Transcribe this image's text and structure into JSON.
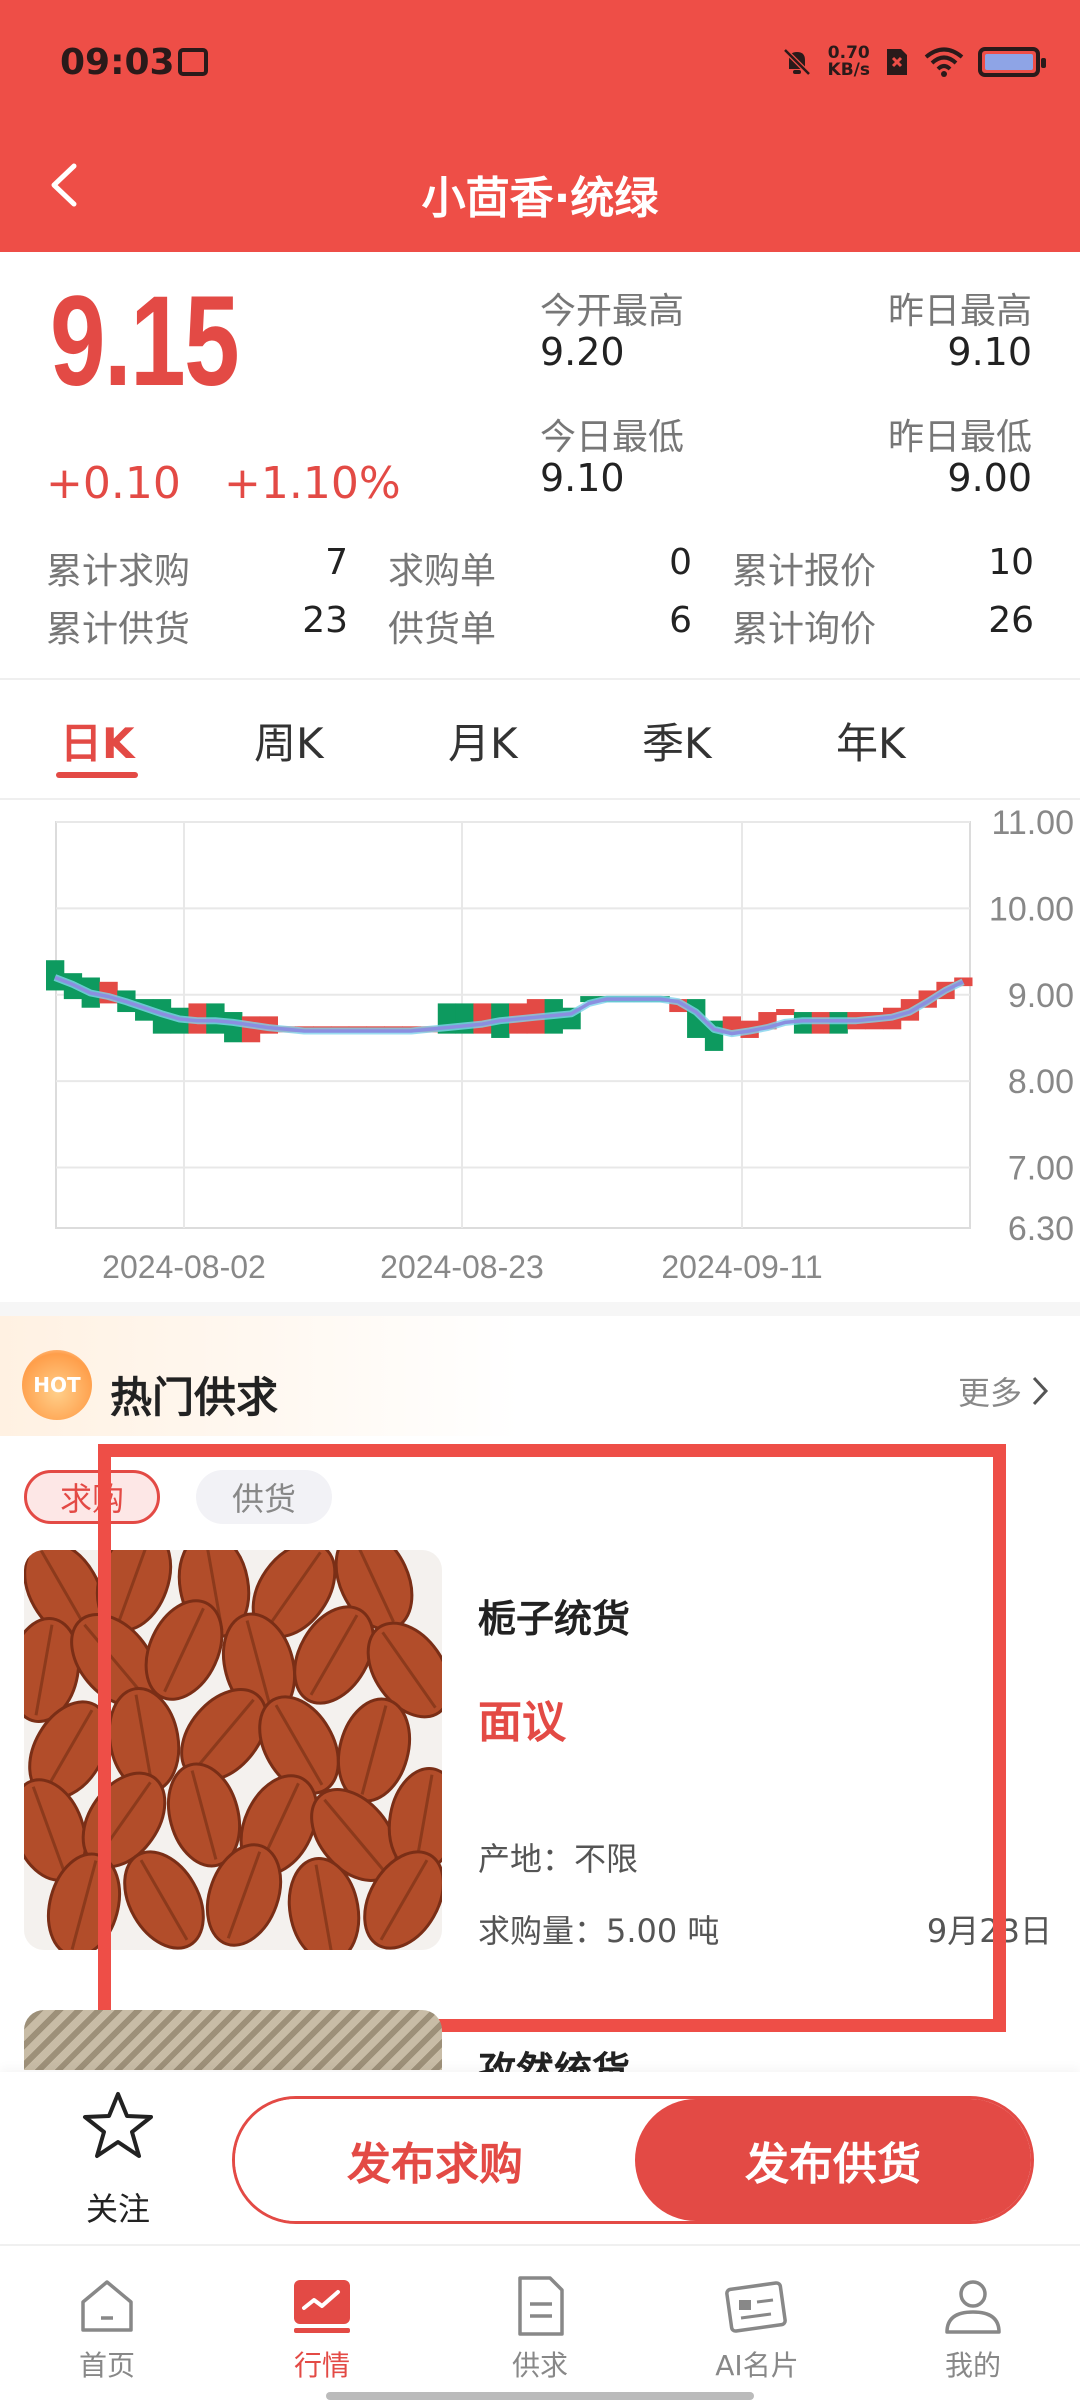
{
  "status_bar": {
    "time": "09:03",
    "net_speed_value": "0.70",
    "net_speed_unit": "KB/s"
  },
  "header": {
    "title": "小茴香·统绿"
  },
  "quote": {
    "price": "9.15",
    "change_abs": "+0.10",
    "change_pct": "+1.10%",
    "today_high_label": "今开最高",
    "today_high_value": "9.20",
    "yesterday_high_label": "昨日最高",
    "yesterday_high_value": "9.10",
    "today_low_label": "今日最低",
    "today_low_value": "9.10",
    "yesterday_low_label": "昨日最低",
    "yesterday_low_value": "9.00"
  },
  "counters": [
    {
      "label": "累计求购",
      "value": "7"
    },
    {
      "label": "求购单",
      "value": "0"
    },
    {
      "label": "累计报价",
      "value": "10"
    },
    {
      "label": "累计供货",
      "value": "23"
    },
    {
      "label": "供货单",
      "value": "6"
    },
    {
      "label": "累计询价",
      "value": "26"
    }
  ],
  "k_tabs": [
    {
      "label": "日K",
      "active": true
    },
    {
      "label": "周K",
      "active": false
    },
    {
      "label": "月K",
      "active": false
    },
    {
      "label": "季K",
      "active": false
    },
    {
      "label": "年K",
      "active": false
    }
  ],
  "chart_data": {
    "type": "candlestick",
    "y_ticks": [
      "11.00",
      "10.00",
      "9.00",
      "8.00",
      "7.00",
      "6.30"
    ],
    "ylim": [
      6.3,
      11.0
    ],
    "x_ticks": [
      "2024-08-02",
      "2024-08-23",
      "2024-09-11"
    ],
    "up_color": "#e34a45",
    "down_color": "#0d9a5f",
    "ma_color": "#8b8fe0",
    "ma_color_secondary": "#7fd3ec",
    "grid": true,
    "candles": [
      {
        "o": 9.4,
        "c": 9.05,
        "dir": "down"
      },
      {
        "o": 9.25,
        "c": 8.95,
        "dir": "down"
      },
      {
        "o": 9.2,
        "c": 8.85,
        "dir": "down"
      },
      {
        "o": 8.9,
        "c": 9.15,
        "dir": "up"
      },
      {
        "o": 9.05,
        "c": 8.8,
        "dir": "down"
      },
      {
        "o": 8.95,
        "c": 8.7,
        "dir": "down"
      },
      {
        "o": 8.95,
        "c": 8.55,
        "dir": "down"
      },
      {
        "o": 8.85,
        "c": 8.55,
        "dir": "down"
      },
      {
        "o": 8.55,
        "c": 8.9,
        "dir": "up"
      },
      {
        "o": 8.9,
        "c": 8.55,
        "dir": "down"
      },
      {
        "o": 8.8,
        "c": 8.45,
        "dir": "down"
      },
      {
        "o": 8.45,
        "c": 8.75,
        "dir": "up"
      },
      {
        "o": 8.55,
        "c": 8.75,
        "dir": "up"
      },
      {
        "o": 8.6,
        "c": 8.6,
        "dir": "up"
      },
      {
        "o": 8.6,
        "c": 8.6,
        "dir": "up"
      },
      {
        "o": 8.6,
        "c": 8.6,
        "dir": "up"
      },
      {
        "o": 8.6,
        "c": 8.6,
        "dir": "up"
      },
      {
        "o": 8.6,
        "c": 8.6,
        "dir": "up"
      },
      {
        "o": 8.6,
        "c": 8.6,
        "dir": "up"
      },
      {
        "o": 8.6,
        "c": 8.6,
        "dir": "up"
      },
      {
        "o": 8.6,
        "c": 8.6,
        "dir": "up"
      },
      {
        "o": 8.6,
        "c": 8.6,
        "dir": "up"
      },
      {
        "o": 8.9,
        "c": 8.55,
        "dir": "down"
      },
      {
        "o": 8.9,
        "c": 8.55,
        "dir": "down"
      },
      {
        "o": 8.55,
        "c": 8.9,
        "dir": "up"
      },
      {
        "o": 8.9,
        "c": 8.5,
        "dir": "down"
      },
      {
        "o": 8.55,
        "c": 8.9,
        "dir": "up"
      },
      {
        "o": 8.55,
        "c": 8.95,
        "dir": "up"
      },
      {
        "o": 8.95,
        "c": 8.55,
        "dir": "down"
      },
      {
        "o": 8.85,
        "c": 8.6,
        "dir": "down"
      },
      {
        "o": 8.95,
        "c": 8.95,
        "dir": "down"
      },
      {
        "o": 8.95,
        "c": 8.95,
        "dir": "down"
      },
      {
        "o": 8.95,
        "c": 8.95,
        "dir": "down"
      },
      {
        "o": 8.95,
        "c": 8.95,
        "dir": "down"
      },
      {
        "o": 8.95,
        "c": 8.95,
        "dir": "down"
      },
      {
        "o": 8.8,
        "c": 8.95,
        "dir": "up"
      },
      {
        "o": 8.95,
        "c": 8.5,
        "dir": "down"
      },
      {
        "o": 8.7,
        "c": 8.35,
        "dir": "down"
      },
      {
        "o": 8.55,
        "c": 8.75,
        "dir": "up"
      },
      {
        "o": 8.5,
        "c": 8.7,
        "dir": "up"
      },
      {
        "o": 8.6,
        "c": 8.8,
        "dir": "up"
      },
      {
        "o": 8.8,
        "c": 8.8,
        "dir": "up"
      },
      {
        "o": 8.8,
        "c": 8.55,
        "dir": "down"
      },
      {
        "o": 8.55,
        "c": 8.8,
        "dir": "up"
      },
      {
        "o": 8.8,
        "c": 8.55,
        "dir": "down"
      },
      {
        "o": 8.6,
        "c": 8.8,
        "dir": "up"
      },
      {
        "o": 8.6,
        "c": 8.8,
        "dir": "up"
      },
      {
        "o": 8.6,
        "c": 8.85,
        "dir": "up"
      },
      {
        "o": 8.7,
        "c": 8.95,
        "dir": "up"
      },
      {
        "o": 8.85,
        "c": 9.05,
        "dir": "up"
      },
      {
        "o": 8.95,
        "c": 9.15,
        "dir": "up"
      },
      {
        "o": 9.1,
        "c": 9.2,
        "dir": "up"
      }
    ],
    "ma": [
      9.2,
      9.12,
      9.02,
      8.98,
      8.92,
      8.85,
      8.78,
      8.72,
      8.7,
      8.7,
      8.68,
      8.65,
      8.62,
      8.6,
      8.58,
      8.58,
      8.58,
      8.58,
      8.58,
      8.58,
      8.58,
      8.6,
      8.62,
      8.64,
      8.66,
      8.7,
      8.72,
      8.74,
      8.76,
      8.78,
      8.9,
      8.95,
      8.95,
      8.95,
      8.95,
      8.92,
      8.8,
      8.6,
      8.55,
      8.58,
      8.62,
      8.68,
      8.7,
      8.7,
      8.7,
      8.7,
      8.72,
      8.74,
      8.8,
      8.92,
      9.05,
      9.15
    ]
  },
  "hot": {
    "badge": "HOT",
    "title": "热门供求",
    "more": "更多"
  },
  "filter_chips": {
    "demand": "求购",
    "supply": "供货"
  },
  "listing": {
    "name": "栀子统货",
    "price": "面议",
    "origin": "产地：不限",
    "quantity": "求购量：5.00 吨",
    "date": "9月23日"
  },
  "next_listing": {
    "name": "孜然统货"
  },
  "actions": {
    "follow": "关注",
    "post_demand": "发布求购",
    "post_supply": "发布供货"
  },
  "tabbar": [
    {
      "label": "首页",
      "icon": "home-icon",
      "active": false
    },
    {
      "label": "行情",
      "icon": "market-chart-icon",
      "active": true
    },
    {
      "label": "供求",
      "icon": "document-icon",
      "active": false
    },
    {
      "label": "AI名片",
      "icon": "business-card-icon",
      "active": false
    },
    {
      "label": "我的",
      "icon": "profile-icon",
      "active": false
    }
  ]
}
